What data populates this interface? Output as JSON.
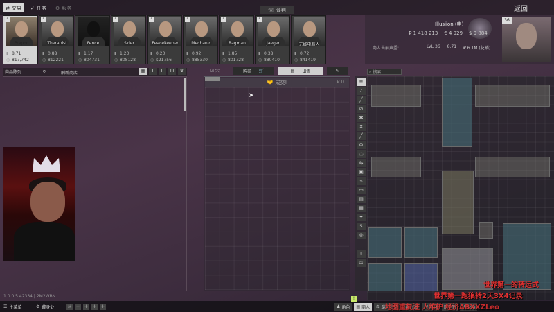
{
  "top_tabs": [
    {
      "label": "交易",
      "icon": "trade-icon"
    },
    {
      "label": "任务",
      "icon": "task-icon"
    },
    {
      "label": "服务",
      "icon": "service-icon"
    }
  ],
  "center_tab": "谈判",
  "back_label": "返回",
  "traders": [
    {
      "name": "Prapor",
      "level": "4",
      "stat1": "8.71",
      "stat2": "817,742",
      "selected": true
    },
    {
      "name": "Therapist",
      "level": "4",
      "stat1": "0.88",
      "stat2": "812221",
      "selected": false
    },
    {
      "name": "Fence",
      "level": "",
      "stat1": "1.17",
      "stat2": "804731",
      "selected": false
    },
    {
      "name": "Skier",
      "level": "4",
      "stat1": "1.23",
      "stat2": "808128",
      "selected": false
    },
    {
      "name": "Peacekeeper",
      "level": "4",
      "stat1": "0.23",
      "stat2": "$21756",
      "selected": false
    },
    {
      "name": "Mechanic",
      "level": "4",
      "stat1": "0.92",
      "stat2": "885330",
      "selected": false
    },
    {
      "name": "Ragman",
      "level": "4",
      "stat1": "1.85",
      "stat2": "801728",
      "selected": false
    },
    {
      "name": "Jaeger",
      "level": "4",
      "stat1": "0.38",
      "stat2": "880410",
      "selected": false
    },
    {
      "name": "无线电商人",
      "level": "",
      "stat1": "0.72",
      "stat2": "841419",
      "selected": false
    }
  ],
  "player": {
    "name": "Illusiion (申)",
    "roubles": "₽ 1 418 213",
    "euros": "€ 4 929",
    "dollars": "$ 9 884",
    "label": "商人当前声望:",
    "level": "LVL 36",
    "standing": "8.71",
    "spent": "₽ 6.1M (花销)",
    "badge": "36"
  },
  "left_panel": {
    "title": "商品陈列",
    "refresh": "刷新商店",
    "view_buttons": [
      "▦",
      "I",
      "II",
      "III",
      "♛"
    ]
  },
  "trade": {
    "buy_label": "购买",
    "sell_label": "出售",
    "deal_label": "成交!",
    "deal_price": "₽ 0"
  },
  "stash": {
    "search_placeholder": "搜索"
  },
  "filters": [
    "≡",
    "⁄",
    "╱",
    "⊘",
    "✱",
    "✕",
    "╱",
    "⚙",
    "◌",
    "⇆",
    "▣",
    "⌁",
    "▭",
    "▤",
    "▦",
    "✦",
    "$",
    "◎",
    "⇩",
    "⚿"
  ],
  "version": "1.0.0.5.42334 | 2M2WBN",
  "bottom_left": [
    {
      "label": "主菜单",
      "icon": "menu-icon"
    },
    {
      "label": "藏身处",
      "icon": "hideout-icon"
    }
  ],
  "bottom_right": [
    {
      "label": "角色",
      "icon": "character-icon"
    },
    {
      "label": "商人",
      "icon": "trader-icon",
      "active": true
    },
    {
      "label": "跳蚤市场",
      "icon": "flea-icon"
    },
    {
      "label": "好友",
      "icon": "friends-icon"
    },
    {
      "label": "消息",
      "icon": "messages-icon"
    },
    {
      "label": "手册",
      "icon": "handbook-icon"
    },
    {
      "label": "关闭",
      "icon": "close-icon"
    }
  ],
  "stream_overlay": [
    "世界第一的转运式",
    "世界第一跑狼转2天3X4记录",
    "地图重复注 人维护 经济ABXXZLeo"
  ],
  "colors": {
    "background": "#3f2e40",
    "accent_light": "#d4d4d4",
    "overlay_red": "#e23030"
  }
}
